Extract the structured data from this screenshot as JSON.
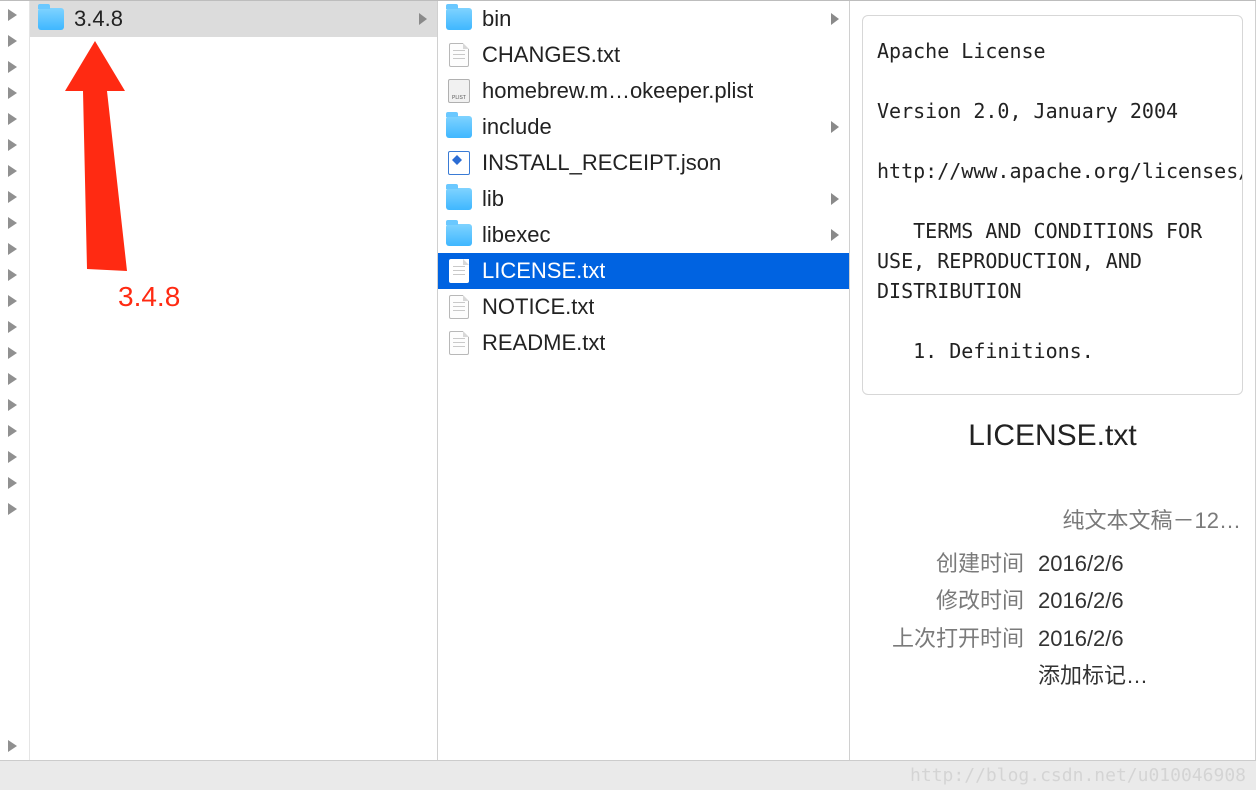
{
  "arrow_strip_count": 21,
  "col1": {
    "items": [
      {
        "name": "3.4.8",
        "type": "folder",
        "selected": "gray",
        "has_children": true
      }
    ]
  },
  "annotation": {
    "label": "3.4.8"
  },
  "col2": {
    "items": [
      {
        "name": "bin",
        "type": "folder",
        "has_children": true
      },
      {
        "name": "CHANGES.txt",
        "type": "txt"
      },
      {
        "name": "homebrew.m…okeeper.plist",
        "type": "plist"
      },
      {
        "name": "include",
        "type": "folder",
        "has_children": true
      },
      {
        "name": "INSTALL_RECEIPT.json",
        "type": "json"
      },
      {
        "name": "lib",
        "type": "folder",
        "has_children": true
      },
      {
        "name": "libexec",
        "type": "folder",
        "has_children": true
      },
      {
        "name": "LICENSE.txt",
        "type": "txt",
        "selected": "blue"
      },
      {
        "name": "NOTICE.txt",
        "type": "txt"
      },
      {
        "name": "README.txt",
        "type": "txt"
      }
    ]
  },
  "preview": {
    "text": "Apache License\n\nVersion 2.0, January 2004\n\nhttp://www.apache.org/licenses/\n\n   TERMS AND CONDITIONS FOR USE, REPRODUCTION, AND DISTRIBUTION\n\n   1. Definitions.",
    "filename": "LICENSE.txt",
    "kind": "纯文本文稿－12…",
    "meta": [
      {
        "k": "创建时间",
        "v": "2016/2/6"
      },
      {
        "k": "修改时间",
        "v": "2016/2/6"
      },
      {
        "k": "上次打开时间",
        "v": "2016/2/6"
      }
    ],
    "add_tag": "添加标记…"
  },
  "watermark": "http://blog.csdn.net/u010046908"
}
